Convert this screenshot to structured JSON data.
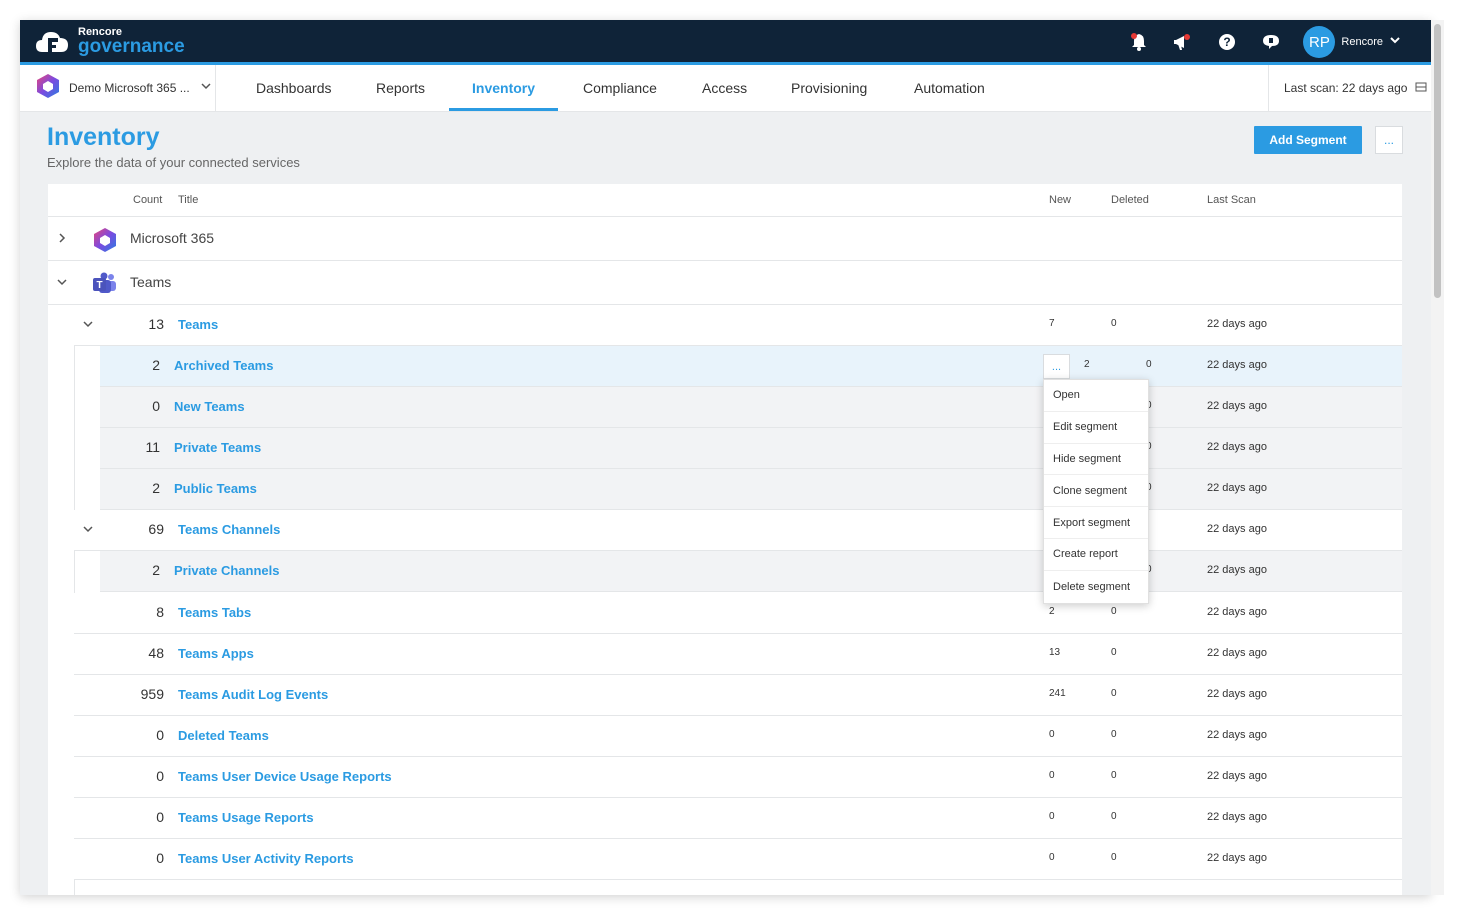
{
  "app": {
    "logo_small": "Rencore",
    "logo_big": "governance",
    "user_initials": "RP",
    "user_name": "Rencore"
  },
  "nav": {
    "tenant": "Demo Microsoft 365 ...",
    "tabs": [
      "Dashboards",
      "Reports",
      "Inventory",
      "Compliance",
      "Access",
      "Provisioning",
      "Automation"
    ],
    "active_tab": "Inventory",
    "last_scan_label": "Last scan:",
    "last_scan_value": "22 days ago"
  },
  "page": {
    "title": "Inventory",
    "subtitle": "Explore the data of your connected services",
    "add_button": "Add Segment",
    "more_button": "..."
  },
  "table": {
    "headers": {
      "count": "Count",
      "title": "Title",
      "new": "New",
      "deleted": "Deleted",
      "last_scan": "Last Scan"
    },
    "groups": [
      {
        "title": "Microsoft 365",
        "expanded": false
      },
      {
        "title": "Teams",
        "expanded": true
      }
    ],
    "rows": [
      {
        "count": "13",
        "title": "Teams",
        "new": "7",
        "deleted": "0",
        "scan": "22 days ago"
      },
      {
        "count": "2",
        "title": "Archived Teams",
        "new": "2",
        "deleted": "0",
        "scan": "22 days ago"
      },
      {
        "count": "0",
        "title": "New Teams",
        "new": "",
        "deleted": "0",
        "scan": "22 days ago"
      },
      {
        "count": "11",
        "title": "Private Teams",
        "new": "",
        "deleted": "0",
        "scan": "22 days ago"
      },
      {
        "count": "2",
        "title": "Public Teams",
        "new": "",
        "deleted": "0",
        "scan": "22 days ago"
      },
      {
        "count": "69",
        "title": "Teams Channels",
        "new": "",
        "deleted": "",
        "scan": "22 days ago"
      },
      {
        "count": "2",
        "title": "Private Channels",
        "new": "",
        "deleted": "0",
        "scan": "22 days ago"
      },
      {
        "count": "8",
        "title": "Teams Tabs",
        "new": "2",
        "deleted": "0",
        "scan": "22 days ago"
      },
      {
        "count": "48",
        "title": "Teams Apps",
        "new": "13",
        "deleted": "0",
        "scan": "22 days ago"
      },
      {
        "count": "959",
        "title": "Teams Audit Log Events",
        "new": "241",
        "deleted": "0",
        "scan": "22 days ago"
      },
      {
        "count": "0",
        "title": "Deleted Teams",
        "new": "0",
        "deleted": "0",
        "scan": "22 days ago"
      },
      {
        "count": "0",
        "title": "Teams User Device Usage Reports",
        "new": "0",
        "deleted": "0",
        "scan": "22 days ago"
      },
      {
        "count": "0",
        "title": "Teams Usage Reports",
        "new": "0",
        "deleted": "0",
        "scan": "22 days ago"
      },
      {
        "count": "0",
        "title": "Teams User Activity Reports",
        "new": "0",
        "deleted": "0",
        "scan": "22 days ago"
      }
    ],
    "row_menu_button": "..."
  },
  "context_menu": {
    "items": [
      "Open",
      "Edit segment",
      "Hide segment",
      "Clone segment",
      "Export segment",
      "Create report",
      "Delete segment"
    ]
  },
  "colors": {
    "accent": "#2b9be2",
    "topbar": "#0f2338"
  },
  "icons": [
    "bell-icon",
    "megaphone-icon",
    "help-icon",
    "feedback-icon",
    "chevron-down-icon",
    "chevron-right-icon",
    "m365-icon",
    "teams-icon",
    "scan-icon"
  ]
}
